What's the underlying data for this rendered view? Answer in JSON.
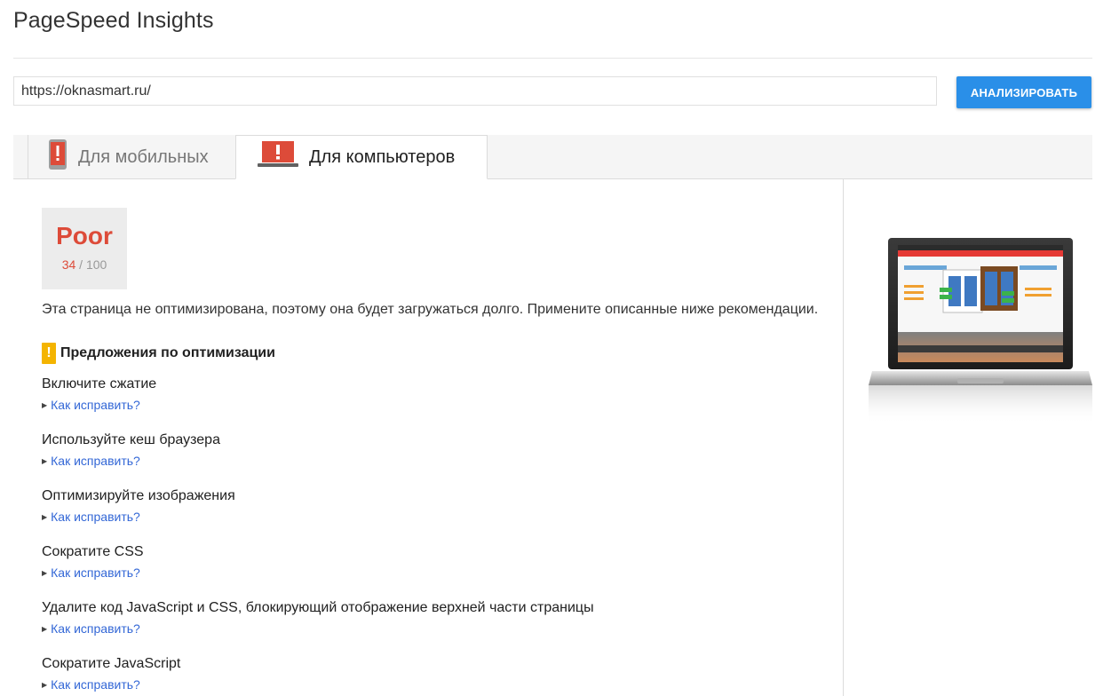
{
  "app": {
    "title": "PageSpeed Insights"
  },
  "search": {
    "value": "https://oknasmart.ru/",
    "analyze_label": "АНАЛИЗИРОВАТЬ"
  },
  "tabs": [
    {
      "label": "Для мобильных",
      "icon": "mobile-phone-icon",
      "active": false
    },
    {
      "label": "Для компьютеров",
      "icon": "laptop-icon",
      "active": true
    }
  ],
  "score": {
    "label": "Poor",
    "value": "34",
    "separator": " / ",
    "max": "100",
    "color": "#dd4b39"
  },
  "summary": "Эта страница не оптимизирована, поэтому она будет загружаться долго. Примените описанные ниже рекомендации.",
  "suggestions": {
    "badge": "!",
    "title": "Предложения по оптимизации",
    "badge_color": "#f4b400",
    "rules": [
      {
        "title": "Включите сжатие",
        "link": "Как исправить?"
      },
      {
        "title": "Используйте кеш браузера",
        "link": "Как исправить?"
      },
      {
        "title": "Оптимизируйте изображения",
        "link": "Как исправить?"
      },
      {
        "title": "Сократите CSS",
        "link": "Как исправить?"
      },
      {
        "title": "Удалите код JavaScript и CSS, блокирующий отображение верхней части страницы",
        "link": "Как исправить?"
      },
      {
        "title": "Сократите JavaScript",
        "link": "Как исправить?"
      }
    ]
  },
  "colors": {
    "accent": "#2a8fe8",
    "link": "#3367d6",
    "poor": "#dd4b39"
  }
}
